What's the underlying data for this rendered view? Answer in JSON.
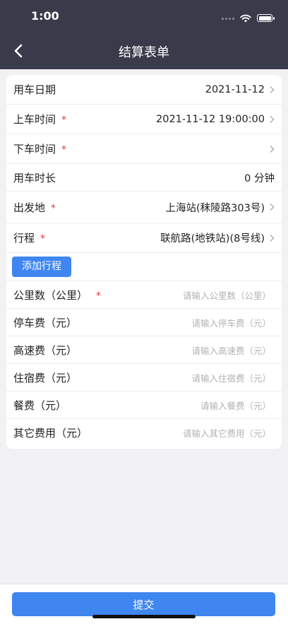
{
  "status_bar": {
    "time": "1:00"
  },
  "nav": {
    "title": "结算表单"
  },
  "form": {
    "required_mark": "*",
    "use_date": {
      "label": "用车日期",
      "value": "2021-11-12"
    },
    "pickup_time": {
      "label": "上车时间",
      "value": "2021-11-12 19:00:00"
    },
    "dropoff_time": {
      "label": "下车时间",
      "value": ""
    },
    "duration": {
      "label": "用车时长",
      "value": "0 分钟"
    },
    "departure": {
      "label": "出发地",
      "value": "上海站(秣陵路303号)"
    },
    "itinerary": {
      "label": "行程",
      "value": "联航路(地铁站)(8号线)"
    },
    "add_itinerary_label": "添加行程",
    "mileage": {
      "label": "公里数（公里）",
      "placeholder": "请输入公里数（公里）"
    },
    "parking": {
      "label": "停车费（元）",
      "placeholder": "请输入停车费（元）"
    },
    "toll": {
      "label": "高速费（元）",
      "placeholder": "请输入高速费（元）"
    },
    "lodging": {
      "label": "住宿费（元）",
      "placeholder": "请输入住宿费（元）"
    },
    "meal": {
      "label": "餐费（元）",
      "placeholder": "请输入餐费（元）"
    },
    "other": {
      "label": "其它费用（元）",
      "placeholder": "请输入其它费用（元）"
    }
  },
  "footer": {
    "submit_label": "提交"
  },
  "colors": {
    "header_bg": "#393a4a",
    "accent": "#3f86f0",
    "required": "#e53c3c"
  }
}
